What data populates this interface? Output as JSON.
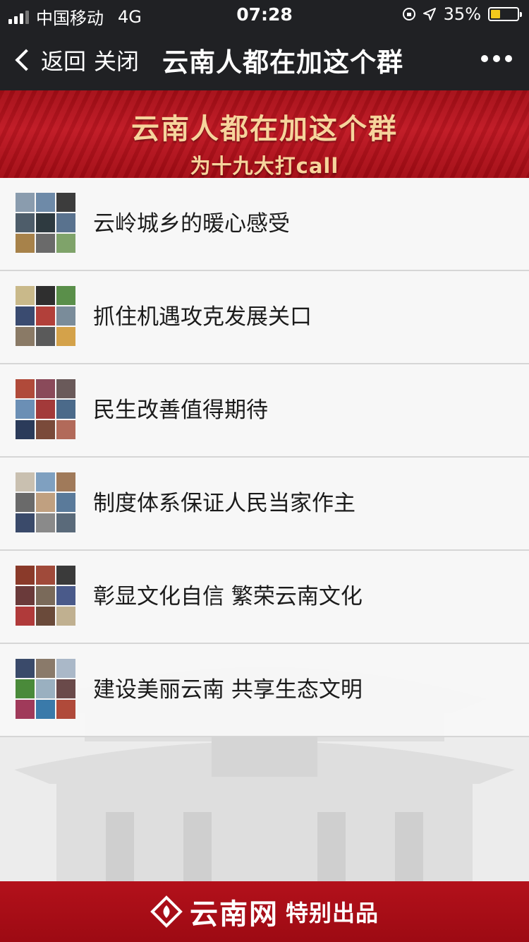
{
  "status_bar": {
    "carrier": "中国移动",
    "network": "4G",
    "time": "07:28",
    "battery": "35%",
    "battery_level": 0.35,
    "battery_color": "#f3c91c"
  },
  "nav": {
    "back_label": "返回",
    "close_label": "关闭",
    "title": "云南人都在加这个群",
    "more_icon": "more-dots-icon"
  },
  "banner": {
    "title": "云南人都在加这个群",
    "subtitle": "为十九大打call"
  },
  "items": [
    {
      "label": "云岭城乡的暖心感受",
      "thumb_colors": [
        "#8a9cae",
        "#6e8aa8",
        "#3c3c3c",
        "#4e5d6a",
        "#2e3a40",
        "#59728e",
        "#a7824a",
        "#6a6a6a",
        "#7fa36a"
      ]
    },
    {
      "label": "抓住机遇攻克发展关口",
      "thumb_colors": [
        "#c9b98a",
        "#2f2f2f",
        "#5a8f4a",
        "#3a4b70",
        "#b2403a",
        "#7a8c9a",
        "#8a7a66",
        "#5a5a5a",
        "#d4a24a"
      ]
    },
    {
      "label": "民生改善值得期待",
      "thumb_colors": [
        "#b04a3a",
        "#8a4a5a",
        "#6a5a5a",
        "#6b8fb5",
        "#a33a3a",
        "#4b6a8a",
        "#2b3b5a",
        "#7a4a3a",
        "#b26a5a"
      ]
    },
    {
      "label": "制度体系保证人民当家作主",
      "thumb_colors": [
        "#c9c0b0",
        "#7fa0c0",
        "#a07a5a",
        "#6a6a6a",
        "#c0a080",
        "#5a7a9a",
        "#3a4a6a",
        "#8a8a8a",
        "#5a6a7a"
      ]
    },
    {
      "label": "彰显文化自信 繁荣云南文化",
      "thumb_colors": [
        "#8a3a2a",
        "#a04a3a",
        "#3a3a3a",
        "#6a3a3a",
        "#7a6a5a",
        "#4a5a8a",
        "#b03a3a",
        "#6a4a3a",
        "#c0b090"
      ]
    },
    {
      "label": "建设美丽云南 共享生态文明",
      "thumb_colors": [
        "#3a4a6a",
        "#8a7a6a",
        "#aab8c8",
        "#4a8a3a",
        "#9ab0c0",
        "#6a4a4a",
        "#a03a5a",
        "#3a7aaa",
        "#b04a3a"
      ]
    }
  ],
  "footer": {
    "brand": "云南网",
    "note": "特别出品"
  }
}
